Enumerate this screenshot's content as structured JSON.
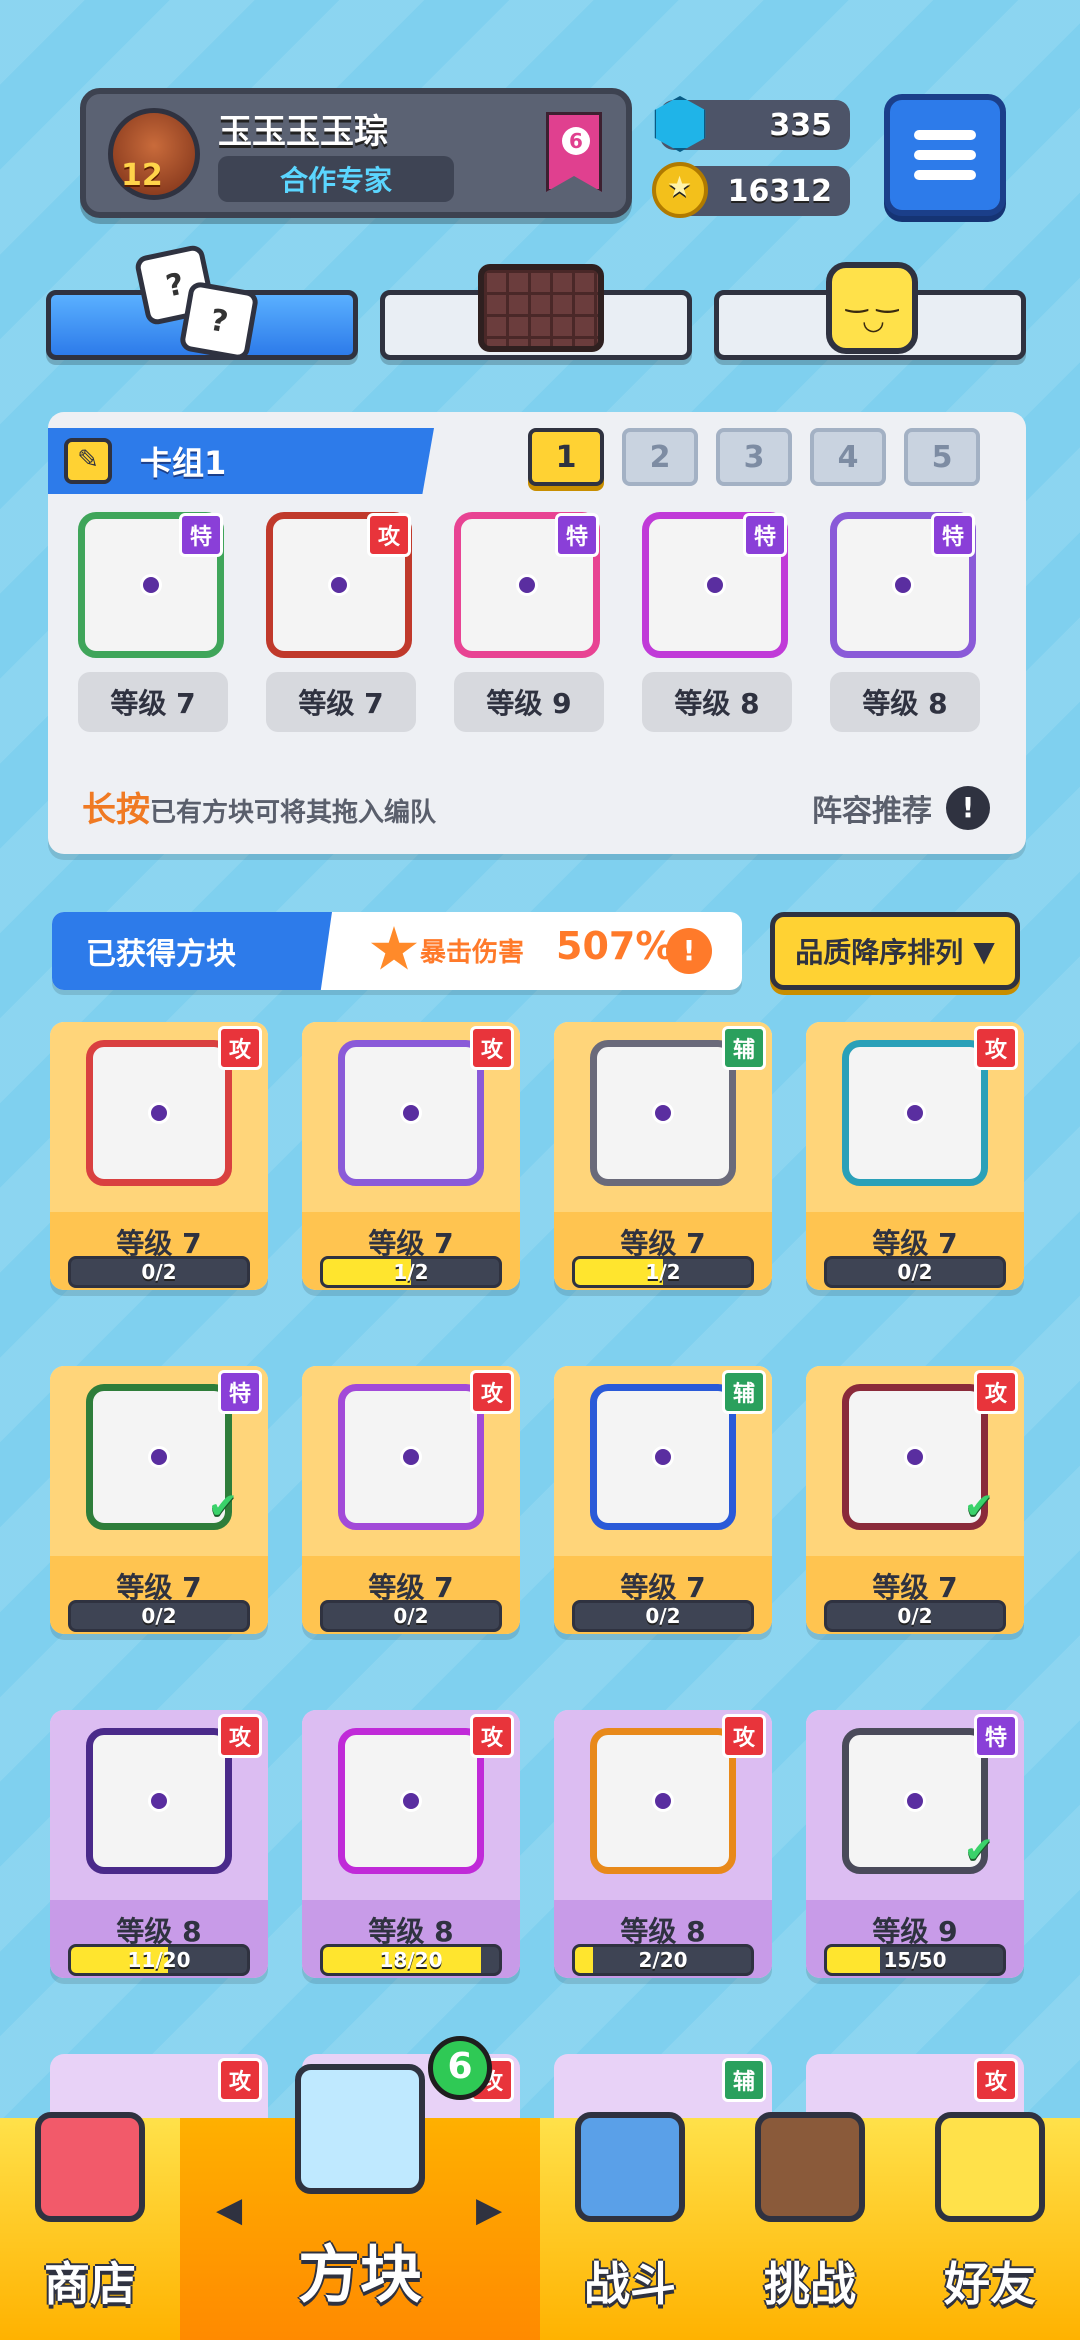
{
  "player": {
    "name": "玉玉玉玉琮",
    "title": "合作专家",
    "level": "12",
    "rank": "6"
  },
  "currency": {
    "gems": "335",
    "coins": "16312"
  },
  "deck": {
    "title": "卡组1",
    "slots": [
      "1",
      "2",
      "3",
      "4",
      "5"
    ],
    "active_slot": "1",
    "cards": [
      {
        "tag": "特",
        "tag_type": "special",
        "level": "等级 7",
        "color": "#3fa55a"
      },
      {
        "tag": "攻",
        "tag_type": "attack",
        "level": "等级 7",
        "color": "#c0392b"
      },
      {
        "tag": "特",
        "tag_type": "special",
        "level": "等级 9",
        "color": "#e84393"
      },
      {
        "tag": "特",
        "tag_type": "special",
        "level": "等级 8",
        "color": "#c03ad8"
      },
      {
        "tag": "特",
        "tag_type": "special",
        "level": "等级 8",
        "color": "#8a5ad8"
      }
    ],
    "hint_highlight": "长按",
    "hint_text": "已有方块可将其拖入编队",
    "lineup_label": "阵容推荐",
    "lineup_icon": "!"
  },
  "owned": {
    "title": "已获得方块",
    "crit_label": "暴击伤害",
    "crit_value": "507%",
    "crit_icon": "!",
    "sort_label": "品质降序排列",
    "cards": [
      {
        "rarity": "gold",
        "tag": "攻",
        "tag_type": "attack",
        "level": "等级 7",
        "progress": "0/2",
        "fill": 0,
        "color": "#d94040",
        "equipped": false
      },
      {
        "rarity": "gold",
        "tag": "攻",
        "tag_type": "attack",
        "level": "等级 7",
        "progress": "1/2",
        "fill": 0.5,
        "color": "#8a5ad8",
        "equipped": false
      },
      {
        "rarity": "gold",
        "tag": "辅",
        "tag_type": "support",
        "level": "等级 7",
        "progress": "1/2",
        "fill": 0.5,
        "color": "#6a6a7a",
        "equipped": false
      },
      {
        "rarity": "gold",
        "tag": "攻",
        "tag_type": "attack",
        "level": "等级 7",
        "progress": "0/2",
        "fill": 0,
        "color": "#2aa0b8",
        "equipped": false
      },
      {
        "rarity": "gold",
        "tag": "特",
        "tag_type": "special",
        "level": "等级 7",
        "progress": "0/2",
        "fill": 0,
        "color": "#2e7d3a",
        "equipped": true
      },
      {
        "rarity": "gold",
        "tag": "攻",
        "tag_type": "attack",
        "level": "等级 7",
        "progress": "0/2",
        "fill": 0,
        "color": "#a24ad8",
        "equipped": false
      },
      {
        "rarity": "gold",
        "tag": "辅",
        "tag_type": "support",
        "level": "等级 7",
        "progress": "0/2",
        "fill": 0,
        "color": "#2a5ad8",
        "equipped": false
      },
      {
        "rarity": "gold",
        "tag": "攻",
        "tag_type": "attack",
        "level": "等级 7",
        "progress": "0/2",
        "fill": 0,
        "color": "#8a2a3a",
        "equipped": true
      },
      {
        "rarity": "purple",
        "tag": "攻",
        "tag_type": "attack",
        "level": "等级 8",
        "progress": "11/20",
        "fill": 0.55,
        "color": "#4a2a8a",
        "equipped": false
      },
      {
        "rarity": "purple",
        "tag": "攻",
        "tag_type": "attack",
        "level": "等级 8",
        "progress": "18/20",
        "fill": 0.9,
        "color": "#c02ad8",
        "equipped": false
      },
      {
        "rarity": "purple",
        "tag": "攻",
        "tag_type": "attack",
        "level": "等级 8",
        "progress": "2/20",
        "fill": 0.1,
        "color": "#e8891a",
        "equipped": false
      },
      {
        "rarity": "purple",
        "tag": "特",
        "tag_type": "special",
        "level": "等级 9",
        "progress": "15/50",
        "fill": 0.3,
        "color": "#4a4a5a",
        "equipped": true
      }
    ],
    "peek_tags": [
      {
        "tag": "攻",
        "tag_type": "attack"
      },
      {
        "tag": "攻",
        "tag_type": "attack"
      },
      {
        "tag": "辅",
        "tag_type": "support"
      },
      {
        "tag": "攻",
        "tag_type": "attack"
      }
    ]
  },
  "nav": {
    "items": [
      {
        "label": "商店",
        "icon": "shop-icon"
      },
      {
        "label": "方块",
        "icon": "block-icon"
      },
      {
        "label": "战斗",
        "icon": "battle-icon"
      },
      {
        "label": "挑战",
        "icon": "challenge-icon"
      },
      {
        "label": "好友",
        "icon": "friends-icon"
      }
    ],
    "active": "方块",
    "badge": "6"
  },
  "colors": {
    "accent_blue": "#2d7bea",
    "accent_yellow": "#ffd233",
    "background": "#7fd0ef"
  }
}
